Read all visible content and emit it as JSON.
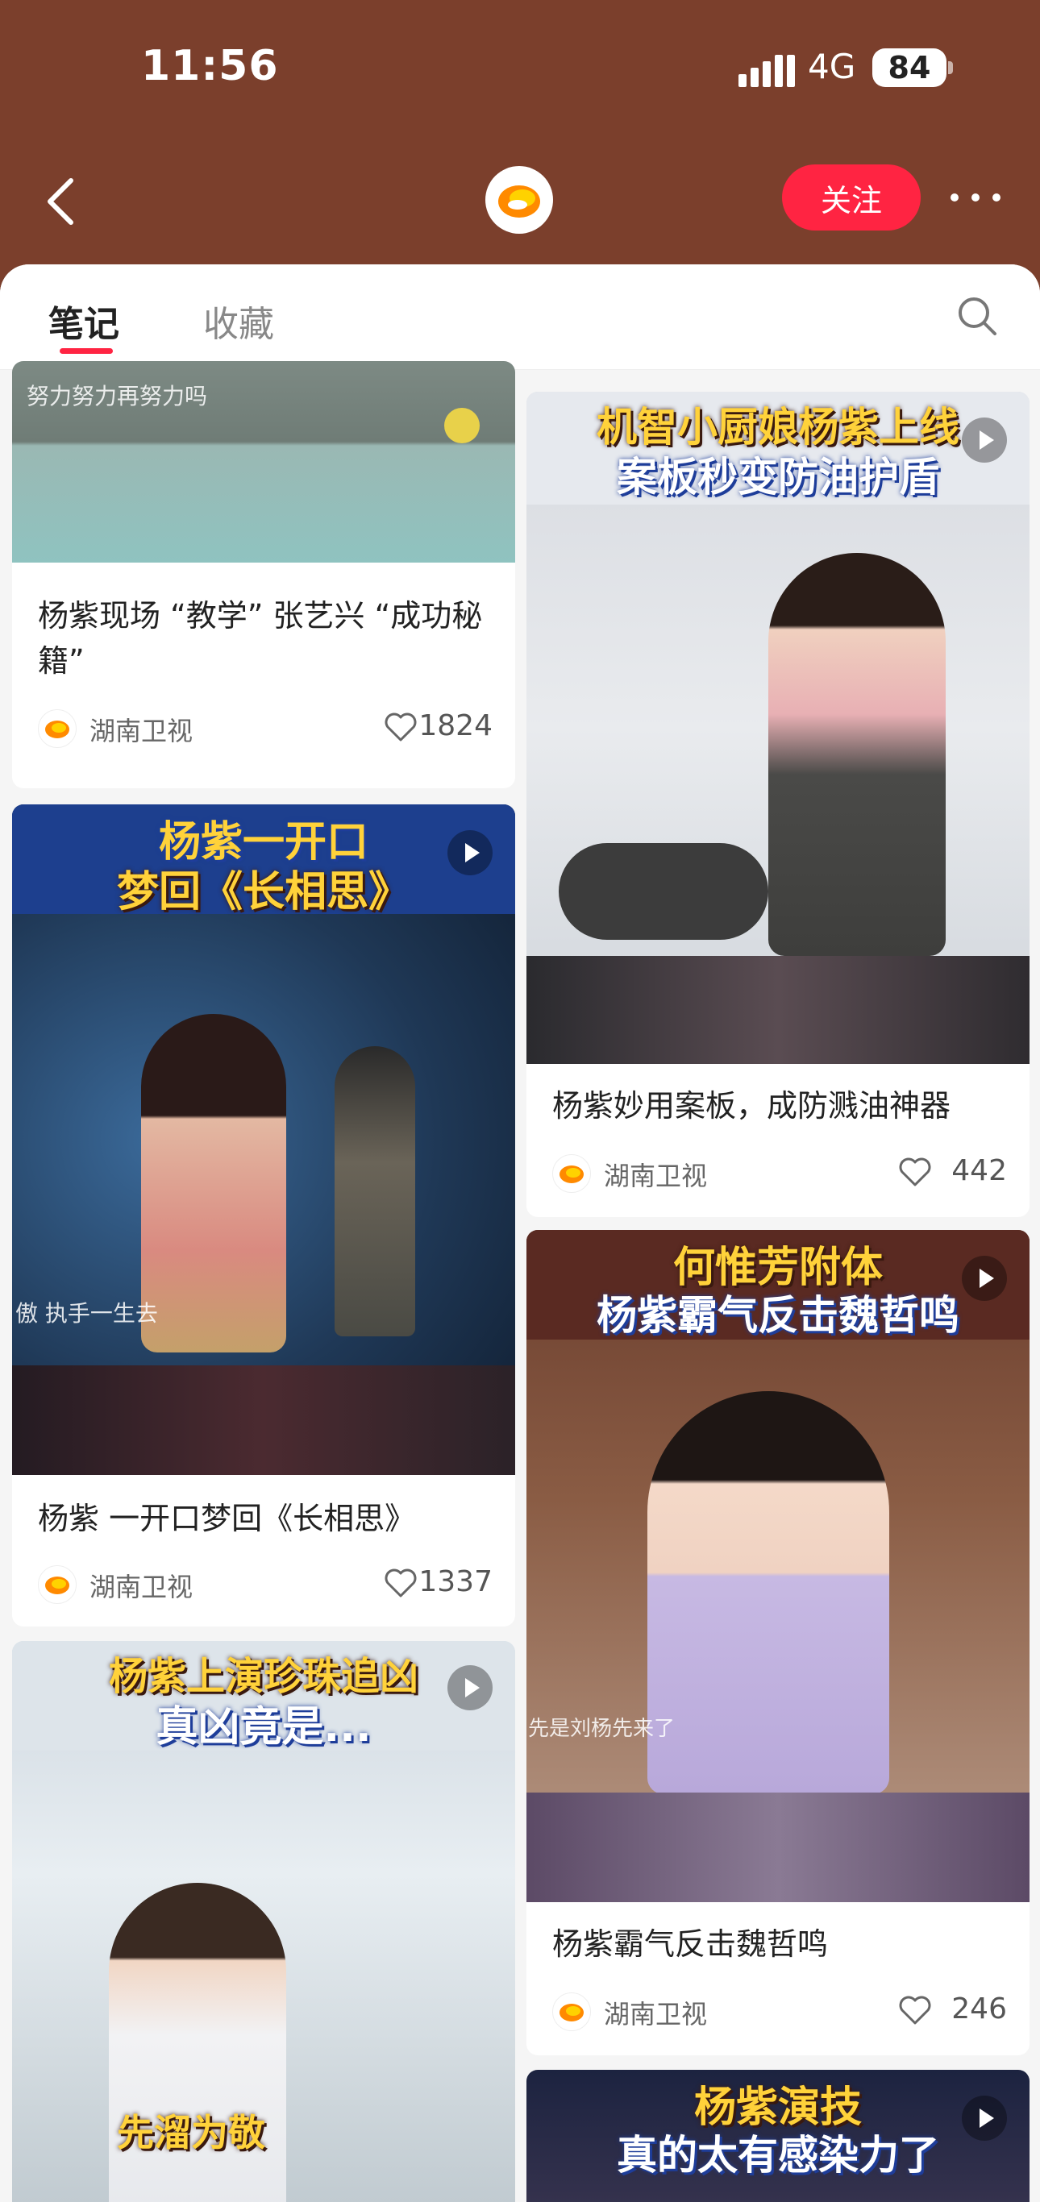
{
  "status_bar": {
    "time": "11:56",
    "network": "4G",
    "battery": "84"
  },
  "nav": {
    "follow_label": "关注"
  },
  "tabs": [
    {
      "label": "笔记",
      "active": true
    },
    {
      "label": "收藏",
      "active": false
    }
  ],
  "cards": [
    {
      "title": "杨紫现场 “教学” 张艺兴 “成功秘籍”",
      "author": "湖南卫视",
      "likes": "1824",
      "overlay_top": "",
      "overlay_bottom": "",
      "caption": "努力努力再努力吗",
      "video": false
    },
    {
      "title": "杨紫 一开口梦回《长相思》",
      "author": "湖南卫视",
      "likes": "1337",
      "overlay_top": "杨紫一开口",
      "overlay_bottom": "梦回《长相思》",
      "caption": "傲 执手一生去",
      "video": true
    },
    {
      "title": "",
      "author": "",
      "likes": "",
      "overlay_top": "杨紫上演珍珠追凶",
      "overlay_bottom": "真凶竟是...",
      "caption": "先溜为敬",
      "video": true
    },
    {
      "title": "杨紫妙用案板，成防溅油神器",
      "author": "湖南卫视",
      "likes": "442",
      "overlay_top": "机智小厨娘杨紫上线",
      "overlay_bottom": "案板秒变防油护盾",
      "caption": "",
      "video": true
    },
    {
      "title": "杨紫霸气反击魏哲鸣",
      "author": "湖南卫视",
      "likes": "246",
      "overlay_top": "何惟芳附体",
      "overlay_bottom": "杨紫霸气反击魏哲鸣",
      "caption": "先是刘杨先来了",
      "video": true
    },
    {
      "title": "",
      "author": "",
      "likes": "",
      "overlay_top": "杨紫演技",
      "overlay_bottom": "真的太有感染力了",
      "caption": "",
      "video": true
    }
  ],
  "colors": {
    "brand_red": "#ff2442",
    "header_bg": "#7b3f2c"
  },
  "icons": [
    "signal-icon",
    "back-icon",
    "hunan-tv-logo",
    "more-icon",
    "search-icon",
    "heart-icon",
    "play-icon"
  ]
}
